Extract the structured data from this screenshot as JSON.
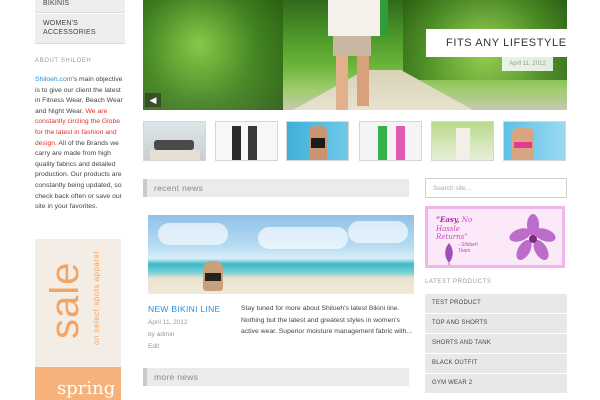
{
  "left_nav": {
    "items": [
      {
        "label": "BIKINIS"
      },
      {
        "label": "WOMEN'S ACCESSORIES"
      }
    ]
  },
  "about": {
    "title": "ABOUT SHILOEH",
    "brand_link": "Shiloeh.com",
    "text_1": "'s main objective is to give our client the latest in Fitness Wear, Beach Wear and Night Wear. ",
    "text_red": "We are constantly circling the Globe for the latest in fashion and design.",
    "text_2": " All of the Brands we carry are made from high quality fabrics and detailed production. Our products are constantly being updated, so check back often or save our site in your favorites."
  },
  "sale_banner": {
    "word": "sale",
    "subtitle": "on select spots apparel",
    "season": "spring"
  },
  "hero": {
    "caption": "FITS ANY LIFESTYLE",
    "date": "April 11, 2012",
    "prev_icon": "arrow-left-icon"
  },
  "thumbnails": [
    {
      "name": "thumb-yoga"
    },
    {
      "name": "thumb-two-women"
    },
    {
      "name": "thumb-bikini-dark"
    },
    {
      "name": "thumb-two-tanks"
    },
    {
      "name": "thumb-outdoor"
    },
    {
      "name": "thumb-pink-bikini"
    }
  ],
  "recent_news": {
    "heading": "recent news",
    "post": {
      "title": "NEW BIKINI LINE",
      "date": "April 11, 2012",
      "by": "by admin",
      "edit": "Edit",
      "excerpt": "Stay tuned for more about Shiloeh's latest Bikini line. Nothing but the latest and greatest styles in women's active wear. Superior moisture management fabric with..."
    }
  },
  "more_news": {
    "heading": "more news"
  },
  "search": {
    "placeholder": "Search site..."
  },
  "ad": {
    "line1": "“Easy,",
    "line1b": "No Hassle",
    "line2": "Returns”",
    "signature": "- Shiloeh\nTeam"
  },
  "latest_products": {
    "title": "LATEST PRODUCTS",
    "items": [
      "TEST PRODUCT",
      "TOP AND SHORTS",
      "SHORTS AND TANK",
      "BLACK OUTFIT",
      "GYM WEAR 2"
    ]
  },
  "colors": {
    "link_blue": "#2a8fd6",
    "highlight_red": "#e0302b",
    "sale_orange": "#f4a566",
    "ad_pink": "#efb6ee"
  }
}
